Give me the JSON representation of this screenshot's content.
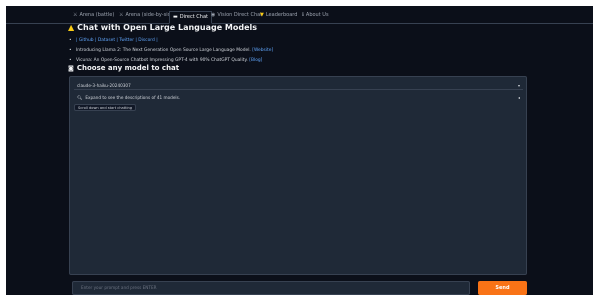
{
  "tabs": [
    {
      "label": "Arena (battle)",
      "icon": "crossed-swords"
    },
    {
      "label": "Arena (side-by-side)",
      "icon": "crossed-swords"
    },
    {
      "label": "Direct Chat",
      "icon": "speech-bubble"
    },
    {
      "label": "Vision Direct Chat",
      "icon": "eye"
    },
    {
      "label": "Leaderboard",
      "icon": "trophy"
    },
    {
      "label": "About Us",
      "icon": "info"
    }
  ],
  "header": {
    "title": "Chat with Open Large Language Models",
    "title_icon": "mountain",
    "links_row": "| Github | Dataset | Twitter | Discord |",
    "announce1": "Introducing Llama 2: The Next Generation Open Source Large Language Model.",
    "announce1_link": "[Website]",
    "announce2": "Vicuna: An Open-Source Chatbot Impressing GPT-4 with 90% ChatGPT Quality.",
    "announce2_link": "[Blog]",
    "choose_title": "Choose any model to chat",
    "choose_icon": "robot"
  },
  "model_select": {
    "value": "claude-3-haiku-20240307"
  },
  "accordion": {
    "label": "Expand to see the descriptions of 41 models."
  },
  "chip": {
    "label": "Scroll down and start chatting"
  },
  "input": {
    "placeholder": "Enter your prompt and press ENTER"
  },
  "send_label": "Send",
  "colors": {
    "background": "#0b0f19",
    "panel": "#1f2937",
    "accent": "#f97316",
    "link": "#60a5fa"
  }
}
